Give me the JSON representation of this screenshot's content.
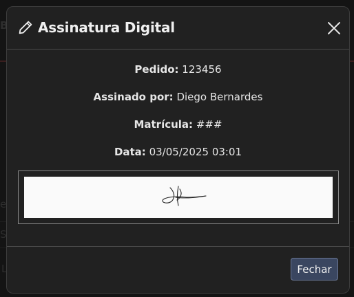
{
  "modal": {
    "title": "Assinatura Digital",
    "icons": {
      "title_icon": "pencil-icon",
      "close_icon": "close-icon"
    },
    "fields": [
      {
        "label": "Pedido:",
        "value": "123456"
      },
      {
        "label": "Assinado por:",
        "value": "Diego Bernardes"
      },
      {
        "label": "Matrícula:",
        "value": "###"
      },
      {
        "label": "Data:",
        "value": "03/05/2025 03:01"
      }
    ],
    "close_button_label": "Fechar"
  },
  "background": {
    "fragments": [
      "B",
      "es",
      "Si",
      "L"
    ]
  },
  "colors": {
    "modal_bg": "#212121",
    "button_bg": "#3a4660",
    "button_border": "#6b7896",
    "signature_bg": "#fafafa"
  }
}
